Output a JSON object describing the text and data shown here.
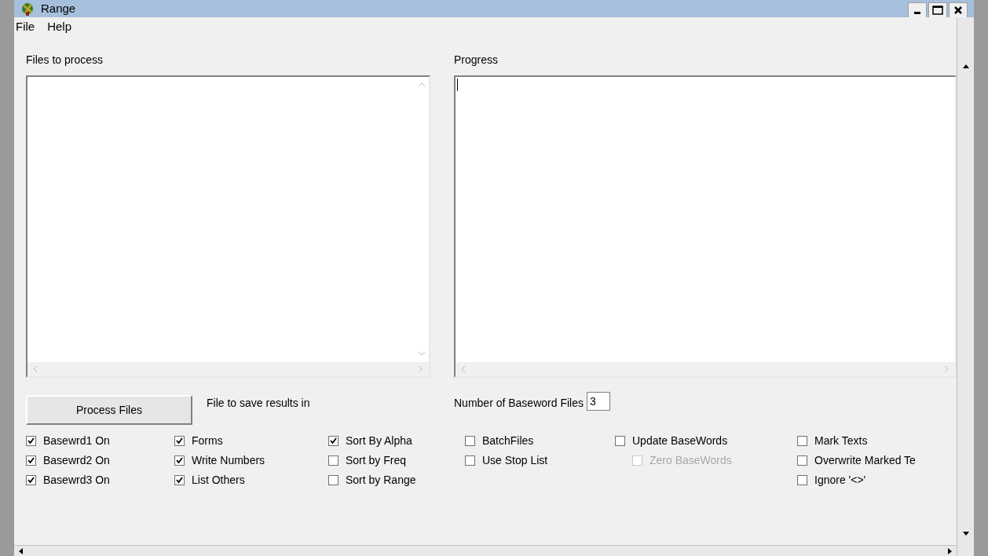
{
  "window": {
    "title": "Range"
  },
  "menu": [
    {
      "label": "File"
    },
    {
      "label": "Help"
    }
  ],
  "files_panel": {
    "label": "Files to process"
  },
  "progress_panel": {
    "label": "Progress"
  },
  "process_button": {
    "label": "Process Files"
  },
  "save_label": "File to save results in",
  "baseword_files": {
    "label": "Number of Baseword Files",
    "value": "3"
  },
  "checkbox_columns": [
    [
      {
        "label": "Basewrd1 On",
        "checked": true,
        "disabled": false
      },
      {
        "label": "Basewrd2 On",
        "checked": true,
        "disabled": false
      },
      {
        "label": "Basewrd3 On",
        "checked": true,
        "disabled": false
      }
    ],
    [
      {
        "label": "Forms",
        "checked": true,
        "disabled": false
      },
      {
        "label": "Write Numbers",
        "checked": true,
        "disabled": false
      },
      {
        "label": "List Others",
        "checked": true,
        "disabled": false
      }
    ],
    [
      {
        "label": "Sort By Alpha",
        "checked": true,
        "disabled": false
      },
      {
        "label": "Sort by Freq",
        "checked": false,
        "disabled": false
      },
      {
        "label": "Sort by Range",
        "checked": false,
        "disabled": false
      }
    ],
    [
      {
        "label": "BatchFiles",
        "checked": false,
        "disabled": false
      },
      {
        "label": "Use Stop List",
        "checked": false,
        "disabled": false
      }
    ],
    [
      {
        "label": "Update BaseWords",
        "checked": false,
        "disabled": false,
        "children": [
          {
            "label": "Zero BaseWords",
            "checked": false,
            "disabled": true
          }
        ]
      }
    ],
    [
      {
        "label": "Mark Texts",
        "checked": false,
        "disabled": false
      },
      {
        "label": "Overwrite Marked Te",
        "checked": false,
        "disabled": false
      },
      {
        "label": "Ignore '<>'",
        "checked": false,
        "disabled": false
      }
    ]
  ]
}
